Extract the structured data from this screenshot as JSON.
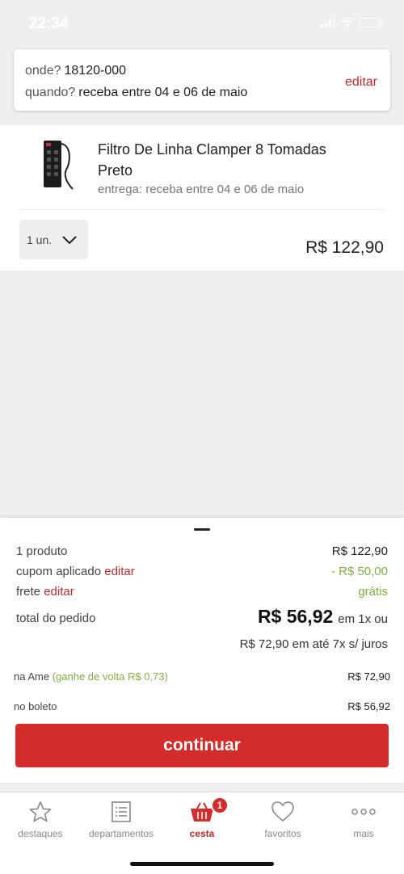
{
  "status_bar": {
    "time": "22:34"
  },
  "delivery": {
    "where_label": "onde?",
    "where_value": "18120-000",
    "when_label": "quando?",
    "when_value": "receba entre 04 e 06 de maio",
    "edit_label": "editar"
  },
  "product": {
    "title": "Filtro De Linha Clamper 8 Tomadas Preto",
    "delivery": "entrega: receba entre 04 e 06 de maio",
    "quantity": "1 un.",
    "price": "R$ 122,90"
  },
  "summary": {
    "products_label": "1 produto",
    "products_value": "R$ 122,90",
    "coupon_label": "cupom aplicado",
    "coupon_edit": "editar",
    "coupon_value": "- R$ 50,00",
    "shipping_label": "frete",
    "shipping_edit": "editar",
    "shipping_value": "grátis",
    "total_label": "total do pedido",
    "total_value": "R$ 56,92",
    "total_suffix": "em 1x ou",
    "installment": "R$ 72,90 em até 7x s/ juros",
    "ame_label": "na Ame",
    "ame_cashback": "(ganhe de volta R$ 0,73)",
    "ame_value": "R$ 72,90",
    "boleto_label": "no boleto",
    "boleto_value": "R$ 56,92",
    "continue_label": "continuar"
  },
  "tabs": [
    {
      "label": "destaques",
      "icon": "star-icon"
    },
    {
      "label": "departamentos",
      "icon": "list-icon"
    },
    {
      "label": "cesta",
      "icon": "basket-icon",
      "active": true,
      "badge": "1"
    },
    {
      "label": "favoritos",
      "icon": "heart-icon"
    },
    {
      "label": "mais",
      "icon": "more-icon"
    }
  ],
  "colors": {
    "brand_red": "#d42b2b",
    "link_red": "#c9282d",
    "green": "#7bb33a",
    "background": "#efefef"
  }
}
